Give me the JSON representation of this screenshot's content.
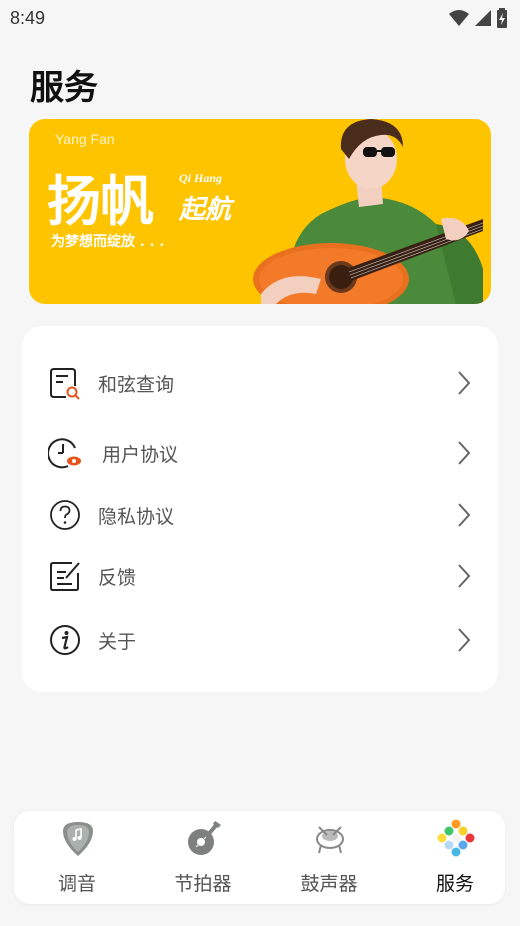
{
  "status_bar": {
    "time": "8:49",
    "icons": [
      "wifi-icon",
      "signal-icon",
      "battery-icon"
    ]
  },
  "page_title": "服务",
  "banner": {
    "en_top": "Yang Fan",
    "big_text": "扬帆",
    "small_en": "Qi Hang",
    "qihang": "起航",
    "slogan": "为梦想而绽放 . . .",
    "background": "#ffc400"
  },
  "menu": [
    {
      "label": "和弦查询",
      "icon": "chord-search-icon"
    },
    {
      "label": "用户协议",
      "icon": "user-agreement-icon"
    },
    {
      "label": "隐私协议",
      "icon": "privacy-help-icon"
    },
    {
      "label": "反馈",
      "icon": "feedback-edit-icon"
    },
    {
      "label": "关于",
      "icon": "info-icon"
    }
  ],
  "tabs": [
    {
      "label": "调音",
      "icon": "pick-tuner-icon",
      "active": false
    },
    {
      "label": "节拍器",
      "icon": "guitar-metronome-icon",
      "active": false
    },
    {
      "label": "鼓声器",
      "icon": "drum-icon",
      "active": false
    },
    {
      "label": "服务",
      "icon": "colorful-dots-icon",
      "active": true
    }
  ],
  "colors": {
    "accent_orange": "#e8531b",
    "active_tab_text": "#111111",
    "inactive_tab_text": "#555555"
  }
}
